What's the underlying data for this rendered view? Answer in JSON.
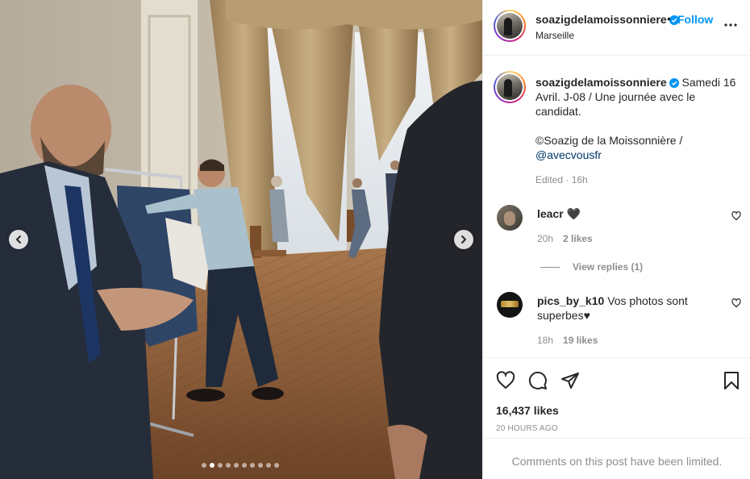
{
  "post": {
    "username": "soazigdelamoissonniere",
    "follow_label": "Follow",
    "bullet": "•",
    "location": "Marseille",
    "more_icon": "more-horizontal-icon"
  },
  "caption": {
    "username": "soazigdelamoissonniere",
    "text_1": "Samedi 16 Avril. J-08 / Une journée avec le candidat.",
    "text_2": "©Soazig de la Moissonnière /",
    "mention": "@avecvousfr",
    "edited": "Edited · 16h"
  },
  "comments": [
    {
      "username": "leacr",
      "text": "🖤",
      "time": "20h",
      "likes": "2 likes",
      "view_replies": "View replies (1)"
    },
    {
      "username": "pics_by_k10",
      "text": "Vos photos sont superbes♥",
      "time": "18h",
      "likes": "19 likes"
    }
  ],
  "actions": {
    "likes": "16,437 likes",
    "time_ago": "20 HOURS AGO",
    "comments_limited": "Comments on this post have been limited."
  },
  "carousel": {
    "slides": 10,
    "active_index": 1
  },
  "colors": {
    "link": "#0095f6",
    "mention": "#00376b",
    "muted": "#8e8e8e",
    "text": "#262626"
  }
}
